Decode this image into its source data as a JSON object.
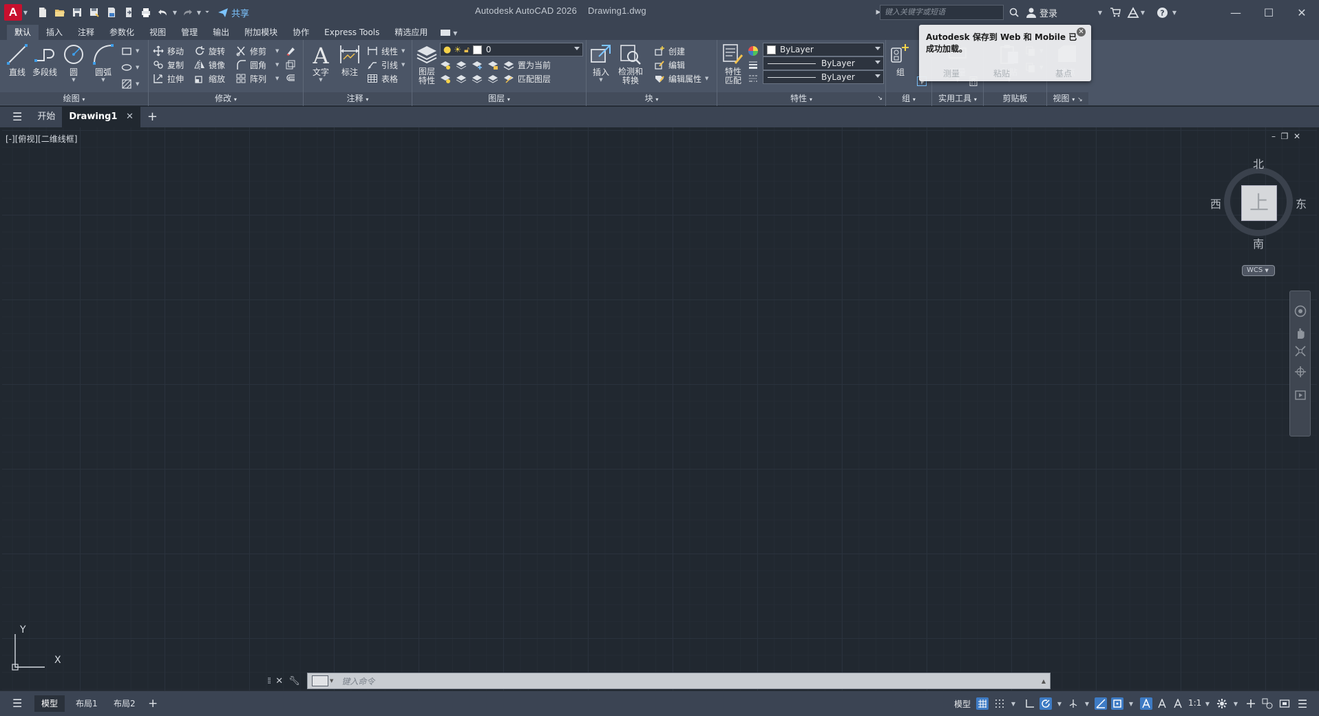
{
  "window": {
    "app_title": "Autodesk AutoCAD 2026",
    "file_title": "Drawing1.dwg",
    "logo_letter": "A"
  },
  "qat": {
    "share_label": "共享"
  },
  "topbar": {
    "search_placeholder": "键入关键字或短语",
    "login_label": "登录"
  },
  "ribbon_tabs": [
    "默认",
    "插入",
    "注释",
    "参数化",
    "视图",
    "管理",
    "输出",
    "附加模块",
    "协作",
    "Express Tools",
    "精选应用"
  ],
  "ribbon_active_tab": 0,
  "panels": {
    "draw": {
      "title": "绘图",
      "line": "直线",
      "polyline": "多段线",
      "circle": "圆",
      "arc": "圆弧"
    },
    "modify": {
      "title": "修改",
      "move": "移动",
      "rotate": "旋转",
      "trim": "修剪",
      "copy": "复制",
      "mirror": "镜像",
      "fillet": "圆角",
      "stretch": "拉伸",
      "scale": "缩放",
      "array": "阵列"
    },
    "annotation": {
      "title": "注释",
      "text": "文字",
      "dimension": "标注",
      "linear": "线性",
      "leader": "引线",
      "table": "表格"
    },
    "layers": {
      "title": "图层",
      "layer_props": "图层\n特性",
      "current_layer": "0",
      "set_current": "置为当前",
      "match_layer": "匹配图层"
    },
    "block": {
      "title": "块",
      "insert": "插入",
      "detect_convert": "检测和\n转换",
      "create": "创建",
      "edit": "编辑",
      "edit_attrs": "编辑属性"
    },
    "properties": {
      "title": "特性",
      "match_props": "特性\n匹配",
      "color_value": "ByLayer",
      "linetype_value": "ByLayer",
      "lineweight_value": "ByLayer"
    },
    "groups": {
      "title": "组",
      "group": "组"
    },
    "utilities": {
      "title": "实用工具",
      "measure": "测量"
    },
    "clipboard": {
      "title": "剪贴板",
      "paste": "粘贴"
    },
    "view": {
      "title": "视图",
      "base": "基点"
    }
  },
  "toast": {
    "message": "Autodesk 保存到 Web 和 Mobile 已成功加载。"
  },
  "file_tabs": {
    "start": "开始",
    "drawing": "Drawing1"
  },
  "viewport": {
    "label": "[-][俯视][二维线框]"
  },
  "viewcube": {
    "north": "北",
    "south": "南",
    "east": "东",
    "west": "西",
    "face": "上",
    "wcs": "WCS"
  },
  "ucs": {
    "x": "X",
    "y": "Y"
  },
  "command": {
    "placeholder": "键入命令"
  },
  "status": {
    "model_label": "模型",
    "layouts": [
      "模型",
      "布局1",
      "布局2"
    ],
    "scale": "1:1"
  },
  "colors": {
    "canvas_bg": "#212830",
    "chrome_bg": "#3b4453",
    "ribbon_bg": "#4b5566",
    "logo_red": "#c8102e",
    "accent_blue": "#3e7bc4"
  }
}
